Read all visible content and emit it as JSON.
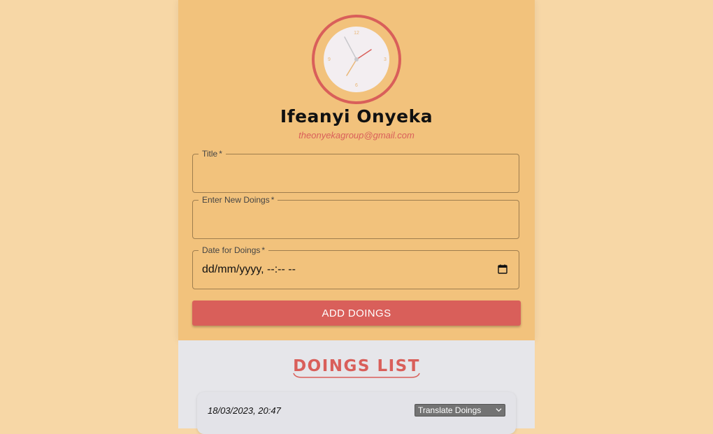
{
  "profile": {
    "name": "Ifeanyi Onyeka",
    "email": "theonyekagroup@gmail.com",
    "clock_numbers": {
      "n12": "12",
      "n3": "3",
      "n6": "6",
      "n9": "9"
    }
  },
  "form": {
    "title_label": "Title",
    "doings_label": "Enter New Doings",
    "date_label": "Date for Doings",
    "required_mark": "*",
    "title_value": "",
    "doings_value": "",
    "date_placeholder": "dd/mm/yyyy, --:-- --",
    "add_button": "ADD DOINGS"
  },
  "list": {
    "title": "DOINGS LIST",
    "items": [
      {
        "date": "18/03/2023, 20:47",
        "translate_label": "Translate Doings"
      }
    ]
  },
  "colors": {
    "page_bg": "#f7d7a6",
    "card_bg": "#f2c27c",
    "accent": "#d95f5a",
    "list_bg": "#e6e6ea"
  },
  "icons": {
    "clock": "clock-icon",
    "calendar": "calendar-icon",
    "chevron": "chevron-down-icon"
  }
}
